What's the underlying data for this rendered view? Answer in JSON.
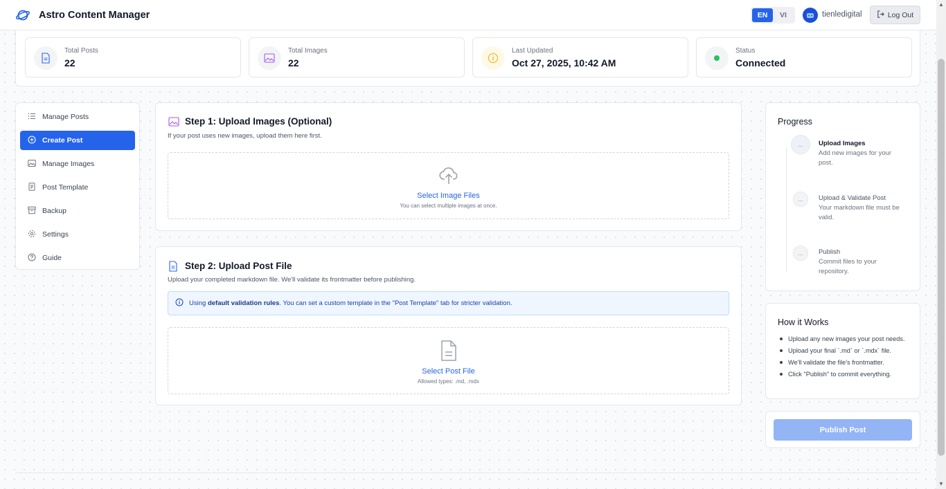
{
  "header": {
    "app_title": "Astro Content Manager",
    "lang_en": "EN",
    "lang_vi": "VI",
    "active_lang": "EN",
    "username": "tienledigital",
    "logout_label": "Log Out"
  },
  "stats": {
    "total_posts_label": "Total Posts",
    "total_posts_value": "22",
    "total_images_label": "Total Images",
    "total_images_value": "22",
    "last_updated_label": "Last Updated",
    "last_updated_value": "Oct 27, 2025, 10:42 AM",
    "status_label": "Status",
    "status_value": "Connected"
  },
  "sidebar": {
    "items": [
      {
        "label": "Manage Posts",
        "icon": "list-icon"
      },
      {
        "label": "Create Post",
        "icon": "plus-circle-icon",
        "active": true
      },
      {
        "label": "Manage Images",
        "icon": "image-icon"
      },
      {
        "label": "Post Template",
        "icon": "template-icon"
      },
      {
        "label": "Backup",
        "icon": "archive-icon"
      },
      {
        "label": "Settings",
        "icon": "gear-icon"
      },
      {
        "label": "Guide",
        "icon": "help-icon"
      }
    ]
  },
  "step1": {
    "title": "Step 1: Upload Images (Optional)",
    "description": "If your post uses new images, upload them here first.",
    "select_label": "Select Image Files",
    "hint": "You can select multiple images at once."
  },
  "step2": {
    "title": "Step 2: Upload Post File",
    "description": "Upload your completed markdown file. We'll validate its frontmatter before publishing.",
    "banner_prefix": "Using ",
    "banner_bold": "default validation rules",
    "banner_suffix": ". You can set a custom template in the \"Post Template\" tab for stricter validation.",
    "select_label": "Select Post File",
    "hint": "Allowed types: .md, .mdx"
  },
  "progress": {
    "title": "Progress",
    "steps": [
      {
        "marker": "...",
        "title": "Upload Images",
        "desc": "Add new images for your post.",
        "active": true
      },
      {
        "marker": "...",
        "title": "Upload & Validate Post",
        "desc": "Your markdown file must be valid."
      },
      {
        "marker": "...",
        "title": "Publish",
        "desc": "Commit files to your repository."
      }
    ]
  },
  "how_it_works": {
    "title": "How it Works",
    "items": [
      "Upload any new images your post needs.",
      "Upload your final `.md` or `.mdx` file.",
      "We'll validate the file's frontmatter.",
      "Click \"Publish\" to commit everything."
    ]
  },
  "publish": {
    "label": "Publish Post"
  },
  "colors": {
    "accent": "#2563eb",
    "status_connected": "#22c55e",
    "publish_disabled": "#93b4f5"
  }
}
